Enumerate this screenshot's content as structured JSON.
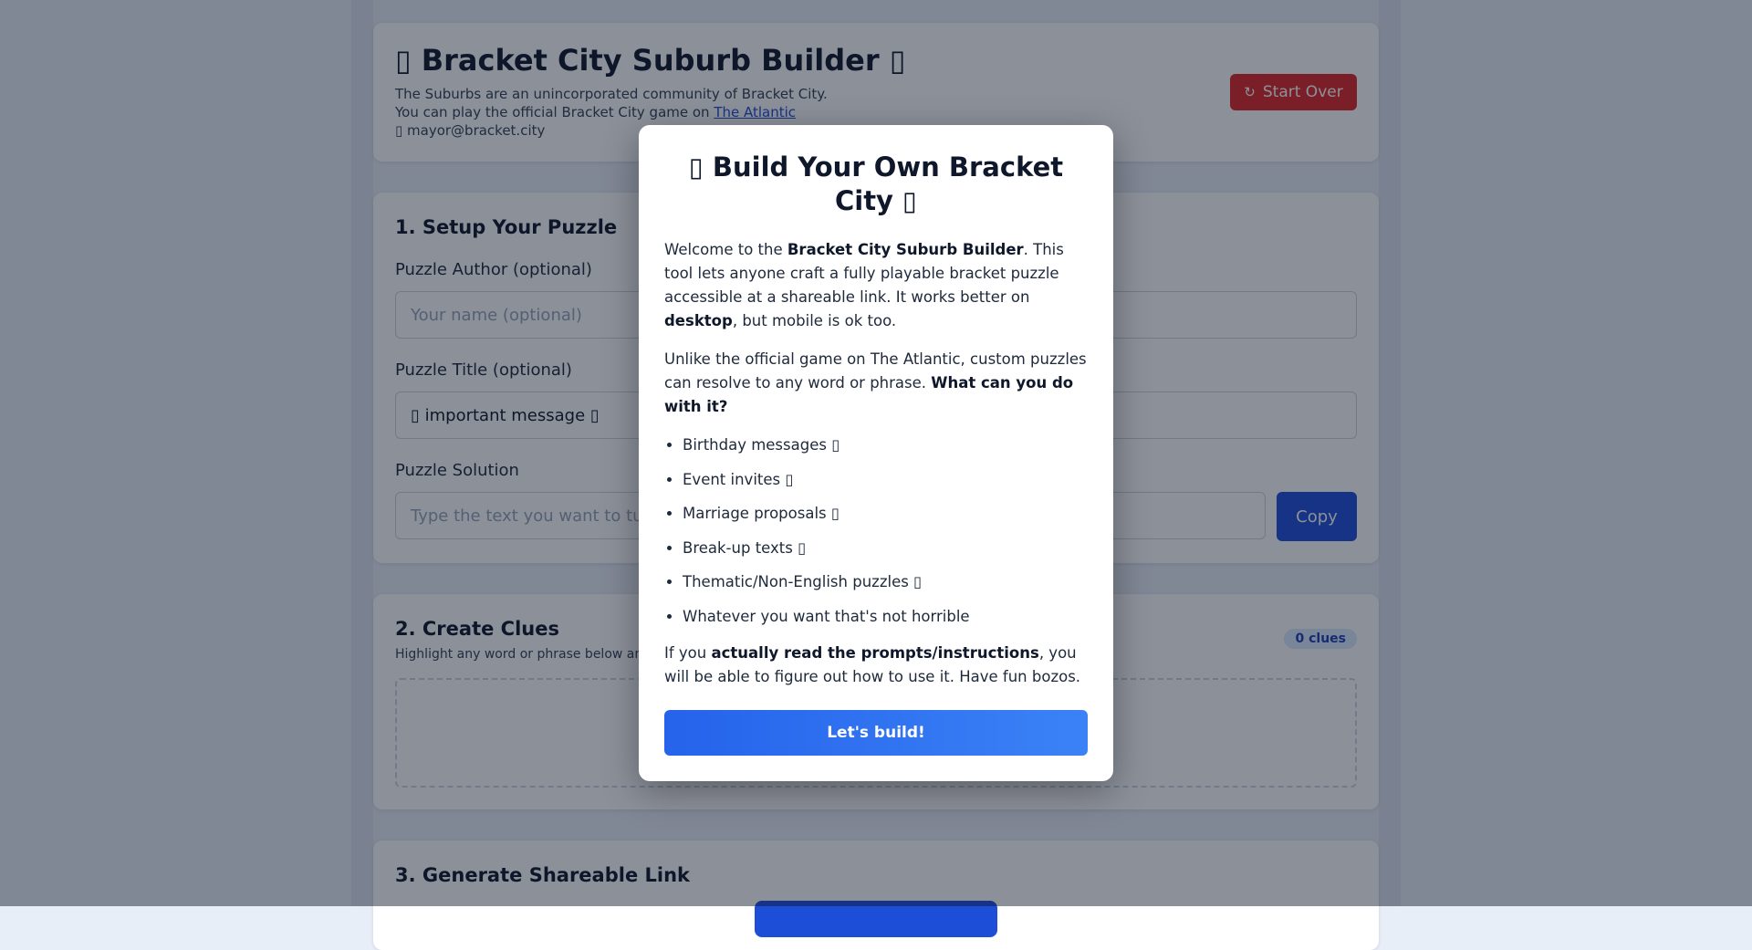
{
  "header": {
    "title": "▯ Bracket City Suburb Builder ▯",
    "line1": "The Suburbs are an unincorporated community of Bracket City.",
    "line2_prefix": "You can play the official Bracket City game on ",
    "line2_link": "The Atlantic",
    "email": "▯ mayor@bracket.city",
    "start_over_icon": "refresh-icon",
    "start_over_icon_glyph": "↻",
    "start_over_label": "Start Over"
  },
  "setup": {
    "title": "1. Setup Your Puzzle",
    "author_label": "Puzzle Author (optional)",
    "author_placeholder": "Your name (optional)",
    "title_label": "Puzzle Title (optional)",
    "title_value": "▯ important message ▯",
    "solution_label": "Puzzle Solution",
    "solution_placeholder": "Type the text you want to turn into a puzzle",
    "copy_label": "Copy"
  },
  "clues": {
    "title": "2. Create Clues",
    "subtitle": "Highlight any word or phrase below and add a clue",
    "count_badge": "0 clues"
  },
  "share": {
    "title": "3. Generate Shareable Link"
  },
  "modal": {
    "title": "▯ Build Your Own Bracket City ▯",
    "p1_a": "Welcome to the ",
    "p1_b": "Bracket City Suburb Builder",
    "p1_c": ". This tool lets anyone craft a fully playable bracket puzzle accessible at a shareable link. It works better on ",
    "p1_d": "desktop",
    "p1_e": ", but mobile is ok too.",
    "p2_a": "Unlike the official game on The Atlantic, custom puzzles can resolve to any word or phrase. ",
    "p2_b": "What can you do with it?",
    "uses": [
      "Birthday messages ▯",
      "Event invites ▯",
      "Marriage proposals ▯",
      "Break-up texts ▯",
      "Thematic/Non-English puzzles ▯",
      "Whatever you want that's not horrible"
    ],
    "p3_a": "If you ",
    "p3_b": "actually read the prompts/instructions",
    "p3_c": ", you will be able to figure out how to use it. Have fun bozos.",
    "build_label": "Let's build!"
  },
  "colors": {
    "accent": "#2563eb",
    "danger": "#dc2626",
    "overlay": "rgba(15,23,42,0.48)"
  }
}
